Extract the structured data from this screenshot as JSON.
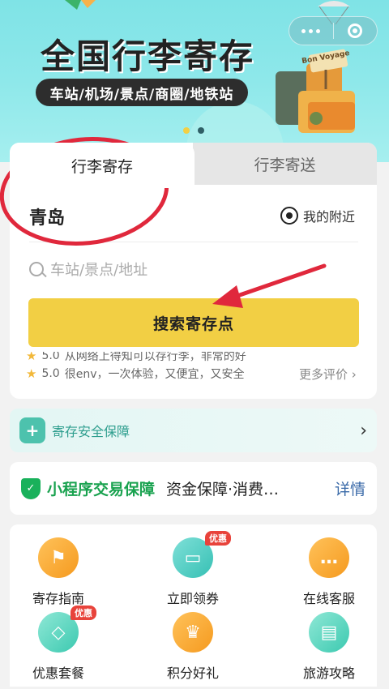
{
  "banner": {
    "title": "全国行李寄存",
    "subtitle": "车站/机场/景点/商圈/地铁站",
    "sign_text": "Bon Voyage",
    "dot_active_color": "#f2cf44",
    "dot_inactive_color": "#2f5f66"
  },
  "capsule": {
    "more_icon": "more-dots-icon",
    "close_icon": "target-close-icon"
  },
  "tabs": [
    {
      "label": "行李寄存",
      "active": true
    },
    {
      "label": "行李寄送",
      "active": false
    }
  ],
  "location": {
    "city": "青岛",
    "nearby_label": "我的附近"
  },
  "search": {
    "placeholder": "车站/景点/地址",
    "button_label": "搜索寄存点"
  },
  "reviews": [
    {
      "score": "5.0",
      "text": "从网络上得知可以存行李，非常的好"
    },
    {
      "score": "5.0",
      "text": "很env，一次体验，又便宜，又安全"
    }
  ],
  "more_reviews": "更多评价",
  "safety": {
    "label": "寄存安全保障"
  },
  "guarantee": {
    "title": "小程序交易保障",
    "desc": "资金保障·消费…",
    "detail": "详情"
  },
  "services": [
    {
      "label": "寄存指南",
      "icon": "signpost-icon",
      "badge": ""
    },
    {
      "label": "立即领券",
      "icon": "ticket-icon",
      "badge": "优惠"
    },
    {
      "label": "在线客服",
      "icon": "chat-icon",
      "badge": ""
    },
    {
      "label": "优惠套餐",
      "icon": "tag-icon",
      "badge": "优惠"
    },
    {
      "label": "积分好礼",
      "icon": "crown-icon",
      "badge": ""
    },
    {
      "label": "旅游攻略",
      "icon": "book-icon",
      "badge": ""
    }
  ],
  "colors": {
    "accent_yellow": "#f2cf44",
    "guarantee_green": "#19a24f",
    "annotation_red": "#e0283c"
  }
}
